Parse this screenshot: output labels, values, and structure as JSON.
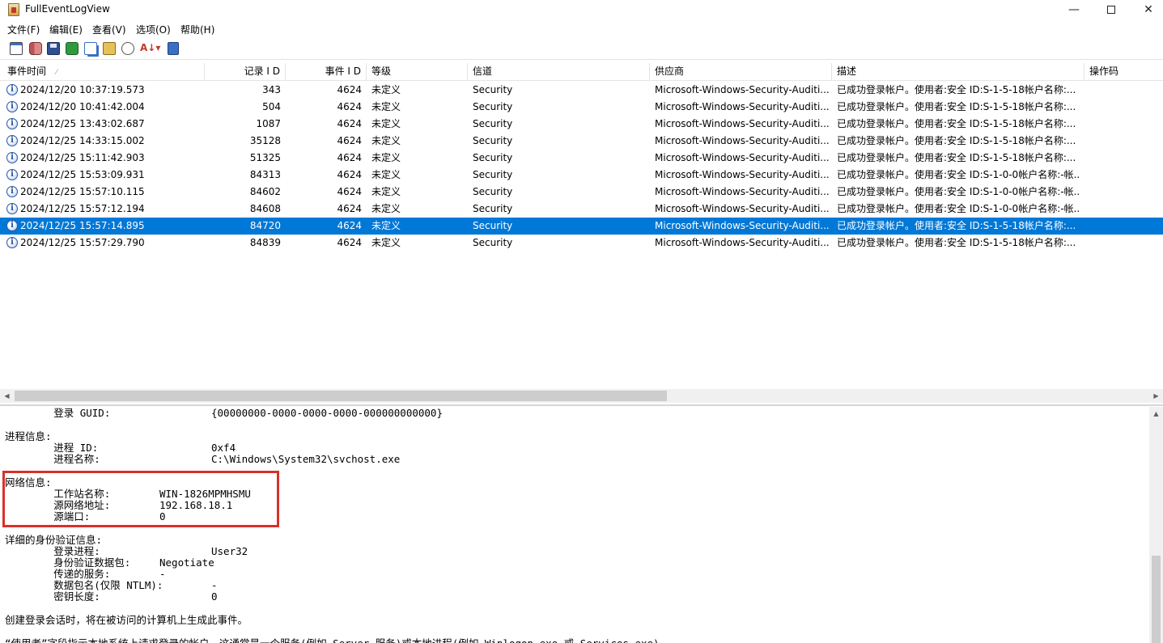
{
  "window": {
    "title": "FullEventLogView",
    "minimize_glyph": "—",
    "close_glyph": "✕"
  },
  "menu": [
    "文件(F)",
    "编辑(E)",
    "查看(V)",
    "选项(O)",
    "帮助(H)"
  ],
  "toolbar": {
    "icons": [
      "properties-icon",
      "database-icon",
      "save-icon",
      "refresh-icon",
      "copy-icon",
      "html-report-icon",
      "find-icon",
      "sort-icon",
      "exit-icon"
    ]
  },
  "table": {
    "columns": [
      "事件时间",
      "记录 I D",
      "事件 I D",
      "等级",
      "信道",
      "供应商",
      "描述",
      "操作码"
    ],
    "sort_indicator": "⁄",
    "rows": [
      {
        "time": "2024/12/20 10:37:19.573",
        "record_id": "343",
        "event_id": "4624",
        "level": "未定义",
        "channel": "Security",
        "provider": "Microsoft-Windows-Security-Auditi...",
        "desc": "已成功登录帐户。使用者:安全 ID:S-1-5-18帐户名称:...",
        "selected": false
      },
      {
        "time": "2024/12/20 10:41:42.004",
        "record_id": "504",
        "event_id": "4624",
        "level": "未定义",
        "channel": "Security",
        "provider": "Microsoft-Windows-Security-Auditi...",
        "desc": "已成功登录帐户。使用者:安全 ID:S-1-5-18帐户名称:...",
        "selected": false
      },
      {
        "time": "2024/12/25 13:43:02.687",
        "record_id": "1087",
        "event_id": "4624",
        "level": "未定义",
        "channel": "Security",
        "provider": "Microsoft-Windows-Security-Auditi...",
        "desc": "已成功登录帐户。使用者:安全 ID:S-1-5-18帐户名称:...",
        "selected": false
      },
      {
        "time": "2024/12/25 14:33:15.002",
        "record_id": "35128",
        "event_id": "4624",
        "level": "未定义",
        "channel": "Security",
        "provider": "Microsoft-Windows-Security-Auditi...",
        "desc": "已成功登录帐户。使用者:安全 ID:S-1-5-18帐户名称:...",
        "selected": false
      },
      {
        "time": "2024/12/25 15:11:42.903",
        "record_id": "51325",
        "event_id": "4624",
        "level": "未定义",
        "channel": "Security",
        "provider": "Microsoft-Windows-Security-Auditi...",
        "desc": "已成功登录帐户。使用者:安全 ID:S-1-5-18帐户名称:...",
        "selected": false
      },
      {
        "time": "2024/12/25 15:53:09.931",
        "record_id": "84313",
        "event_id": "4624",
        "level": "未定义",
        "channel": "Security",
        "provider": "Microsoft-Windows-Security-Auditi...",
        "desc": "已成功登录帐户。使用者:安全 ID:S-1-0-0帐户名称:-帐...",
        "selected": false
      },
      {
        "time": "2024/12/25 15:57:10.115",
        "record_id": "84602",
        "event_id": "4624",
        "level": "未定义",
        "channel": "Security",
        "provider": "Microsoft-Windows-Security-Auditi...",
        "desc": "已成功登录帐户。使用者:安全 ID:S-1-0-0帐户名称:-帐...",
        "selected": false
      },
      {
        "time": "2024/12/25 15:57:12.194",
        "record_id": "84608",
        "event_id": "4624",
        "level": "未定义",
        "channel": "Security",
        "provider": "Microsoft-Windows-Security-Auditi...",
        "desc": "已成功登录帐户。使用者:安全 ID:S-1-0-0帐户名称:-帐...",
        "selected": false
      },
      {
        "time": "2024/12/25 15:57:14.895",
        "record_id": "84720",
        "event_id": "4624",
        "level": "未定义",
        "channel": "Security",
        "provider": "Microsoft-Windows-Security-Auditi...",
        "desc": "已成功登录帐户。使用者:安全 ID:S-1-5-18帐户名称:...",
        "selected": true
      },
      {
        "time": "2024/12/25 15:57:29.790",
        "record_id": "84839",
        "event_id": "4624",
        "level": "未定义",
        "channel": "Security",
        "provider": "Microsoft-Windows-Security-Auditi...",
        "desc": "已成功登录帐户。使用者:安全 ID:S-1-5-18帐户名称:...",
        "selected": false
      }
    ]
  },
  "detail": {
    "lines": [
      {
        "label": "        登录 GUID:",
        "value": "{00000000-0000-0000-0000-000000000000}"
      },
      {
        "label": "",
        "value": ""
      },
      {
        "label": "进程信息:",
        "value": ""
      },
      {
        "label": "        进程 ID:",
        "value": "0xf4"
      },
      {
        "label": "        进程名称:",
        "value": "C:\\Windows\\System32\\svchost.exe"
      },
      {
        "label": "",
        "value": ""
      },
      {
        "label": "网络信息:",
        "value": ""
      },
      {
        "label": "        工作站名称:",
        "value": "WIN-1826MPMHSMU"
      },
      {
        "label": "        源网络地址:",
        "value": "192.168.18.1"
      },
      {
        "label": "        源端口:",
        "value": "0"
      },
      {
        "label": "",
        "value": ""
      },
      {
        "label": "详细的身份验证信息:",
        "value": ""
      },
      {
        "label": "        登录进程:",
        "value": "User32"
      },
      {
        "label": "        身份验证数据包:",
        "value": "Negotiate"
      },
      {
        "label": "        传递的服务:",
        "value": "-"
      },
      {
        "label": "        数据包名(仅限 NTLM):",
        "value": "-"
      },
      {
        "label": "        密钥长度:",
        "value": "0"
      },
      {
        "label": "",
        "value": ""
      },
      {
        "label": "创建登录会话时，将在被访问的计算机上生成此事件。",
        "value": ""
      },
      {
        "label": "",
        "value": ""
      },
      {
        "label": "“使用者”字段指示本地系统上请求登录的帐户。这通常是一个服务(例如 Server 服务)或本地进程(例如 Winlogon.exe 或 Services.exe)。",
        "value": ""
      }
    ]
  },
  "highlight_color": "#d9302b",
  "selection_color": "#0078d7"
}
